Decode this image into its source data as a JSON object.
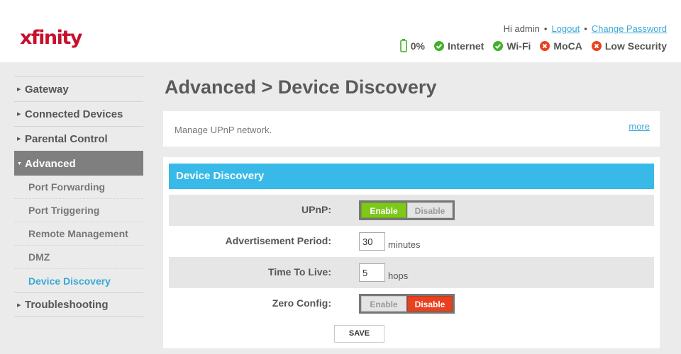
{
  "header": {
    "logo": "xfinity",
    "greeting": "Hi admin",
    "logout": "Logout",
    "change_password": "Change Password",
    "status": [
      {
        "icon": "battery-icon",
        "label": "0%",
        "state": "battery"
      },
      {
        "icon": "check-circle-icon",
        "label": "Internet",
        "state": "ok"
      },
      {
        "icon": "check-circle-icon",
        "label": "Wi-Fi",
        "state": "ok"
      },
      {
        "icon": "x-circle-icon",
        "label": "MoCA",
        "state": "error"
      },
      {
        "icon": "x-circle-icon",
        "label": "Low Security",
        "state": "error"
      }
    ]
  },
  "colors": {
    "brand": "#c8102e",
    "accent": "#38b9e8",
    "ok": "#44b02a",
    "error": "#e8411f",
    "enable_on": "#7dc81b"
  },
  "sidebar": {
    "items": [
      {
        "label": "Gateway"
      },
      {
        "label": "Connected Devices"
      },
      {
        "label": "Parental Control"
      },
      {
        "label": "Advanced",
        "active": true
      },
      {
        "label": "Troubleshooting"
      }
    ],
    "sub_items": [
      {
        "label": "Port Forwarding"
      },
      {
        "label": "Port Triggering"
      },
      {
        "label": "Remote Management"
      },
      {
        "label": "DMZ"
      },
      {
        "label": "Device Discovery",
        "active": true
      }
    ]
  },
  "main": {
    "title": "Advanced > Device Discovery",
    "info_text": "Manage UPnP network.",
    "more_link": "more",
    "panel_title": "Device Discovery",
    "upnp": {
      "label": "UPnP:",
      "enable": "Enable",
      "disable": "Disable",
      "value": "Enable"
    },
    "advertisement": {
      "label": "Advertisement Period:",
      "value": "30",
      "unit": "minutes"
    },
    "ttl": {
      "label": "Time To Live:",
      "value": "5",
      "unit": "hops"
    },
    "zero_config": {
      "label": "Zero Config:",
      "enable": "Enable",
      "disable": "Disable",
      "value": "Disable"
    },
    "save": "SAVE"
  }
}
